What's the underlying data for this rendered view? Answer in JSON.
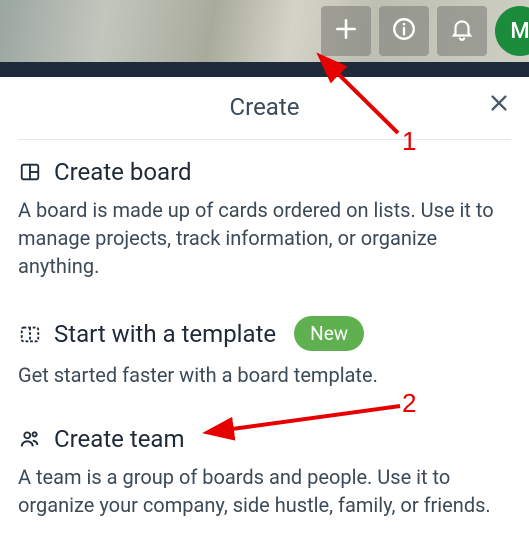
{
  "topbar": {
    "avatar_initial": "M"
  },
  "popover": {
    "title": "Create"
  },
  "options": {
    "create_board": {
      "title": "Create board",
      "desc": "A board is made up of cards ordered on lists. Use it to manage projects, track information, or organize anything."
    },
    "start_template": {
      "title": "Start with a template",
      "badge": "New",
      "desc": "Get started faster with a board template."
    },
    "create_team": {
      "title": "Create team",
      "desc": "A team is a group of boards and people. Use it to organize your company, side hustle, family, or friends."
    }
  },
  "annotations": {
    "label1": "1",
    "label2": "2"
  }
}
